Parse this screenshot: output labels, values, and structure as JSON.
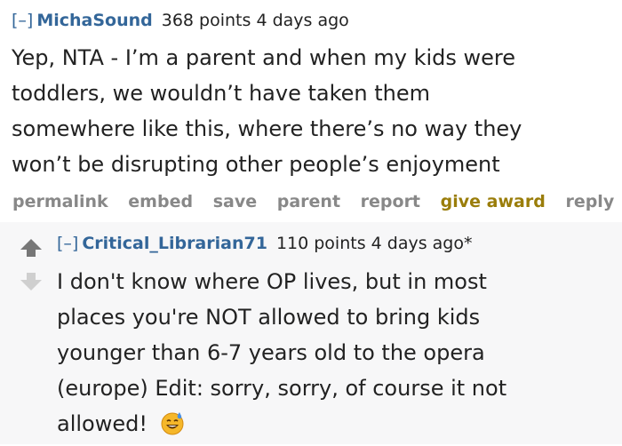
{
  "comment1": {
    "toggle": "[–]",
    "author": "MichaSound",
    "meta": "368 points 4 days ago",
    "lines": [
      "Yep, NTA - I’m a parent and when my kids were",
      "toddlers, we wouldn’t have taken them",
      "somewhere like this, where there’s no way they",
      "won’t be disrupting other people’s enjoyment"
    ],
    "actions": {
      "permalink": "permalink",
      "embed": "embed",
      "save": "save",
      "parent": "parent",
      "report": "report",
      "give_award": "give award",
      "reply": "reply"
    }
  },
  "comment2": {
    "toggle": "[–]",
    "author": "Critical_Librarian71",
    "meta": "110 points 4 days ago*",
    "lines": [
      "I don't know where OP lives, but in most",
      "places you're NOT allowed to bring kids",
      "younger than 6-7 years old to the opera",
      "(europe) Edit: sorry, sorry, of course it not",
      "allowed!"
    ],
    "emoji": "grinning-sweat-emoji"
  },
  "colors": {
    "author": "#336699",
    "action_gray": "#888888",
    "award_gold": "#9a7d0a",
    "reply_bg": "#f7f7f8"
  }
}
